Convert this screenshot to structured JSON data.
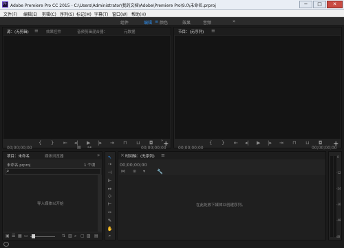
{
  "window": {
    "title": "Adobe Premiere Pro CC 2015 - C:\\Users\\Administrator\\我的文档\\Adobe\\Premiere Pro\\9.0\\未命名.prproj",
    "app_icon": "Pr",
    "minimize": "−",
    "maximize": "□",
    "close": "✕"
  },
  "menu": [
    "文件(F)",
    "编辑(E)",
    "剪辑(C)",
    "序列(S)",
    "标记(M)",
    "字幕(T)",
    "窗口(W)",
    "帮助(H)"
  ],
  "workspaces": {
    "items": [
      "组件",
      "编辑",
      "颜色",
      "效果",
      "音频"
    ],
    "active": "编辑",
    "more": "»",
    "active_marker": "≡"
  },
  "source_panel": {
    "tabs": [
      "源：(无剪辑)",
      "效果控件",
      "音频剪辑混合器：",
      "元数据"
    ],
    "menu_icon": "≡",
    "timecode_left": "00;00;00;00",
    "timecode_right": "00;00;00;00",
    "plus": "+"
  },
  "program_panel": {
    "tab": "节目：(无序列)",
    "menu_icon": "≡",
    "timecode_left": "00;00;00;00",
    "timecode_right": "00;00;00;00",
    "plus": "+"
  },
  "project_panel": {
    "tabs": [
      "项目：未命名",
      "媒体浏览器"
    ],
    "more": "»",
    "file_name": "未命名.prproj",
    "item_count": "1 个项",
    "search_icon": "⌕",
    "empty_text": "导入媒体以开始"
  },
  "timeline_panel": {
    "close": "×",
    "tab": "时间轴：(无序列)",
    "menu_icon": "≡",
    "timecode": "00;00;00;00",
    "empty_text": "在此处放下媒体以创建序列。"
  },
  "audio_meter": {
    "labels": [
      "0",
      "-12",
      "-24",
      "-36",
      "-48",
      "dB"
    ]
  },
  "colors": {
    "accent": "#2d8ceb",
    "panel_bg": "#232323",
    "title_bar": "#e9eef5"
  }
}
